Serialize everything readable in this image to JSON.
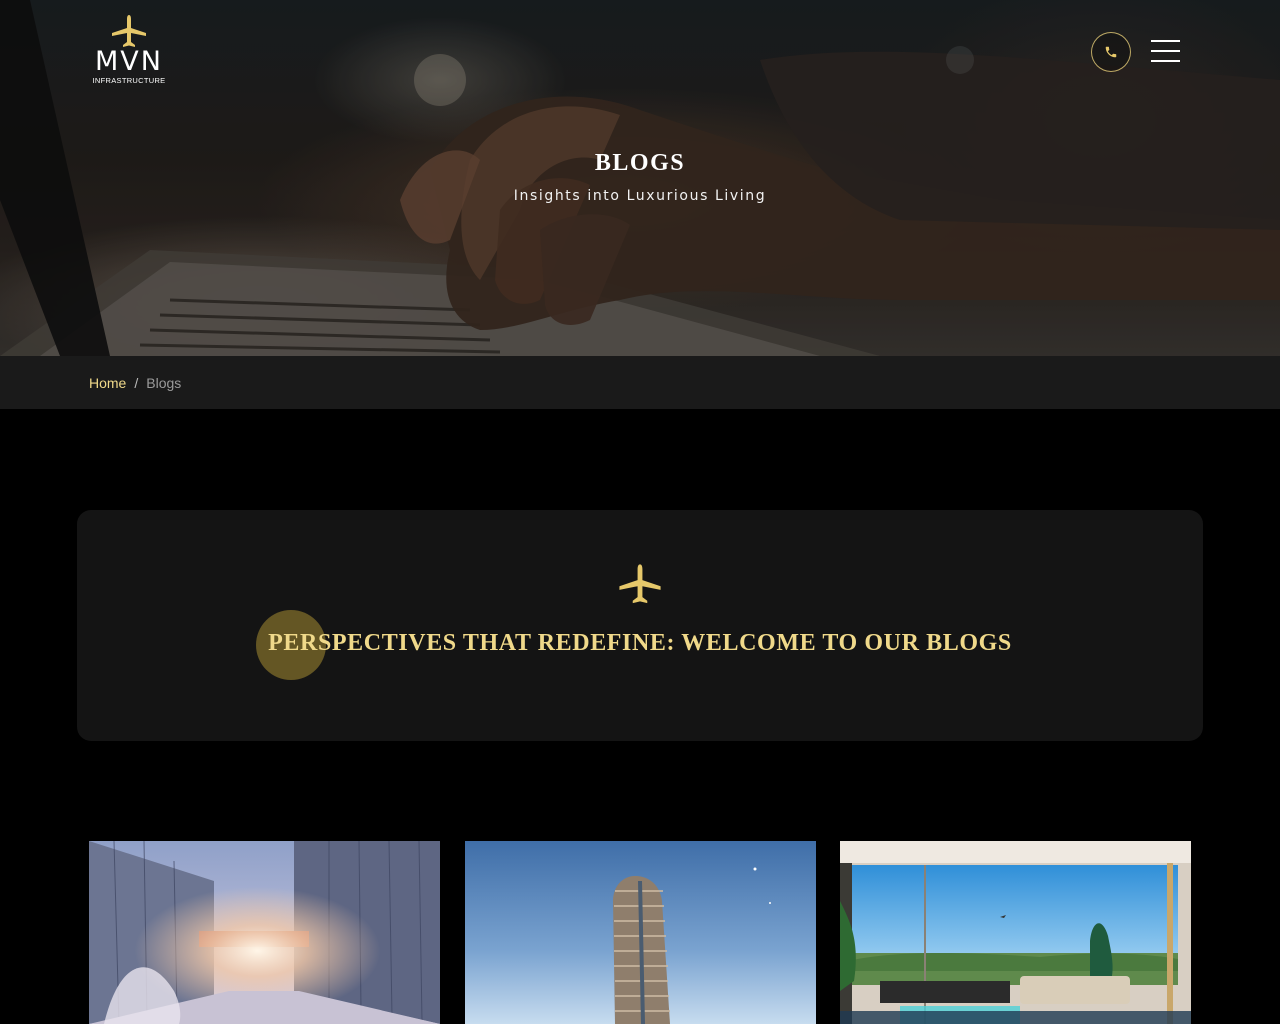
{
  "header": {
    "logo": {
      "wordmark": "MVN",
      "tagline": "INFRASTRUCTURE",
      "icon": "airplane-icon"
    },
    "phone_icon": "phone-icon",
    "menu_icon": "hamburger-menu-icon"
  },
  "hero": {
    "title": "BLOGS",
    "subtitle": "Insights into Luxurious Living"
  },
  "breadcrumb": {
    "home": "Home",
    "separator": "/",
    "current": "Blogs"
  },
  "welcome": {
    "icon": "airplane-icon",
    "title": "PERSPECTIVES THAT REDEFINE: WELCOME TO OUR BLOGS"
  },
  "blog_cards": [
    {
      "image": "glass-office-buildings-photo"
    },
    {
      "image": "residential-tower-photo"
    },
    {
      "image": "luxury-living-room-photo"
    }
  ],
  "colors": {
    "accent_gold": "#f0d98a",
    "page_bg": "#000000",
    "panel_bg": "#141414",
    "breadcrumb_bg": "#1a1a1a"
  }
}
